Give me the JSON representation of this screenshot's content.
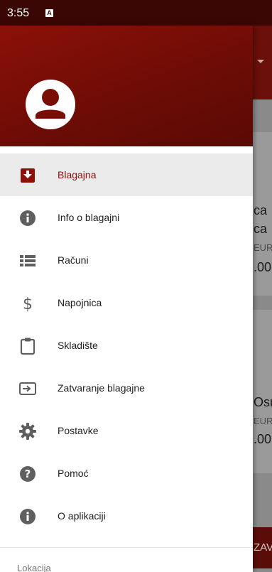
{
  "status_bar": {
    "time": "3:55",
    "notification_icon": "a-badge-icon"
  },
  "background": {
    "lines": [
      "ca",
      "ca",
      "EUR",
      ".00",
      "Osn",
      "EUR",
      ".00"
    ],
    "footer_text": "ZAV"
  },
  "drawer": {
    "header": {
      "avatar_icon": "account-circle-icon"
    },
    "menu": [
      {
        "label": "Blagajna",
        "icon": "cash-register-icon",
        "active": true
      },
      {
        "label": "Info o blagajni",
        "icon": "info-icon"
      },
      {
        "label": "Računi",
        "icon": "list-icon"
      },
      {
        "label": "Napojnica",
        "icon": "dollar-icon"
      },
      {
        "label": "Skladište",
        "icon": "clipboard-icon"
      },
      {
        "label": "Zatvaranje blagajne",
        "icon": "exit-icon"
      },
      {
        "label": "Postavke",
        "icon": "gear-icon"
      },
      {
        "label": "Pomoć",
        "icon": "help-icon"
      },
      {
        "label": "O aplikaciji",
        "icon": "info-icon"
      }
    ],
    "section_label": "Lokacija"
  },
  "colors": {
    "accent": "#8b1108",
    "header_dark": "#5a0a05",
    "status_bar": "#3a0704",
    "icon_gray": "#5f5f5f"
  }
}
